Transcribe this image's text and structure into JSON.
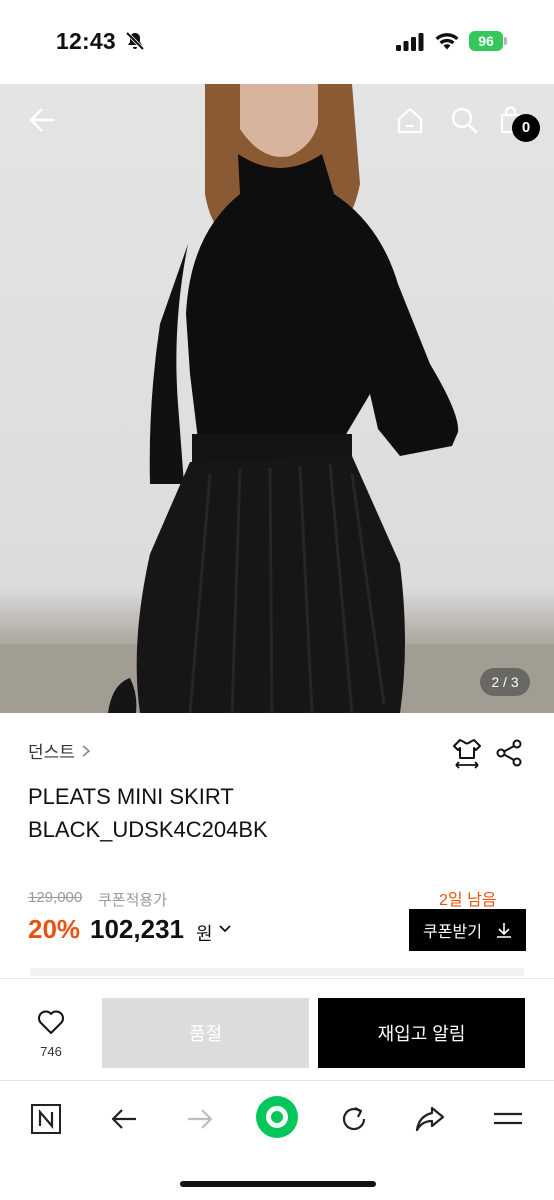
{
  "status_bar": {
    "time": "12:43",
    "battery": "96",
    "icons": [
      "bell-slash-icon",
      "signal-icon",
      "wifi-icon",
      "battery-icon"
    ]
  },
  "hero": {
    "pager": "2 / 3",
    "cart_count": "0",
    "icons": [
      "back-arrow-icon",
      "home-icon",
      "search-icon",
      "shopping-bag-icon"
    ]
  },
  "product": {
    "brand": "던스트",
    "name_line1": "PLEATS MINI SKIRT",
    "name_line2": "BLACK_UDSK4C204BK",
    "original_price": "129,000",
    "coupon_note": "쿠폰적용가",
    "days_left": "2일 남음",
    "discount": "20%",
    "price": "102,231",
    "currency": "원",
    "coupon_button": "쿠폰받기"
  },
  "action_bar": {
    "like_count": "746",
    "soldout_label": "품절",
    "restock_label": "재입고 알림"
  },
  "browser_toolbar": {
    "icons": [
      "naver-n-icon",
      "back-icon",
      "forward-icon",
      "green-dot-icon",
      "refresh-icon",
      "share-arrow-icon",
      "menu-icon"
    ]
  },
  "colors": {
    "accent": "#e8530e",
    "battery": "#34c759",
    "green_button": "#03c75a",
    "soldout": "#dcdcdc"
  }
}
